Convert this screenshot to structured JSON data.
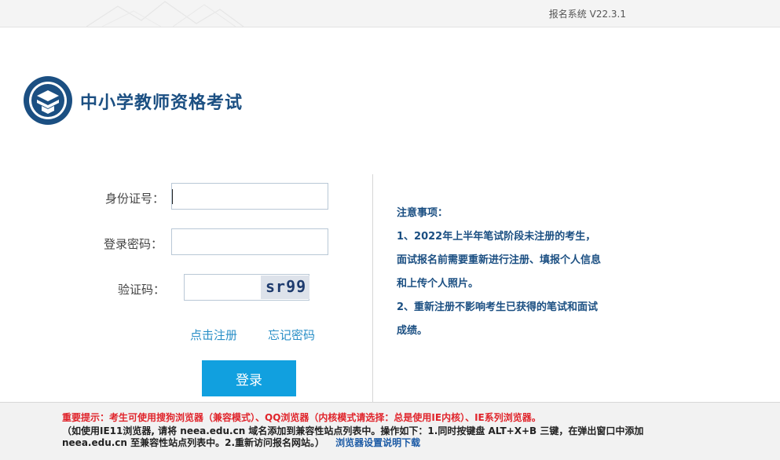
{
  "header": {
    "version": "报名系统  V22.3.1"
  },
  "brand": {
    "title": "中小学教师资格考试",
    "logo_icon": "exam-logo-icon"
  },
  "form": {
    "id_label": "身份证号：",
    "id_value": "",
    "password_label": "登录密码：",
    "password_value": "",
    "captcha_label": "验证码：",
    "captcha_value": "",
    "captcha_text": "sr99",
    "register_link": "点击注册",
    "forgot_link": "忘记密码",
    "login_button": "登录"
  },
  "notice": {
    "title": "注意事项：",
    "lines": [
      "1、2022年上半年笔试阶段未注册的考生，",
      "面试报名前需要重新进行注册、填报个人信息",
      "和上传个人照片。",
      "2、重新注册不影响考生已获得的笔试和面试",
      "成绩。"
    ]
  },
  "footer": {
    "important": "重要提示：考生可使用搜狗浏览器（兼容模式）、QQ浏览器（内核模式请选择：总是使用IE内核）、IE系列浏览器。",
    "instruction_1": "（如使用IE11浏览器, 请将 neea.edu.cn 域名添加到兼容性站点列表中。操作如下：1.同时按键盘 ALT+X+B 三键，在弹出窗口中添加",
    "instruction_2": "neea.edu.cn 至兼容性站点列表中。2.重新访问报名网站。）",
    "download_link": "浏览器设置说明下载"
  },
  "colors": {
    "brand": "#1b4f82",
    "button": "#11a0df",
    "link": "#2a8fc7",
    "warning": "#e0242b"
  }
}
